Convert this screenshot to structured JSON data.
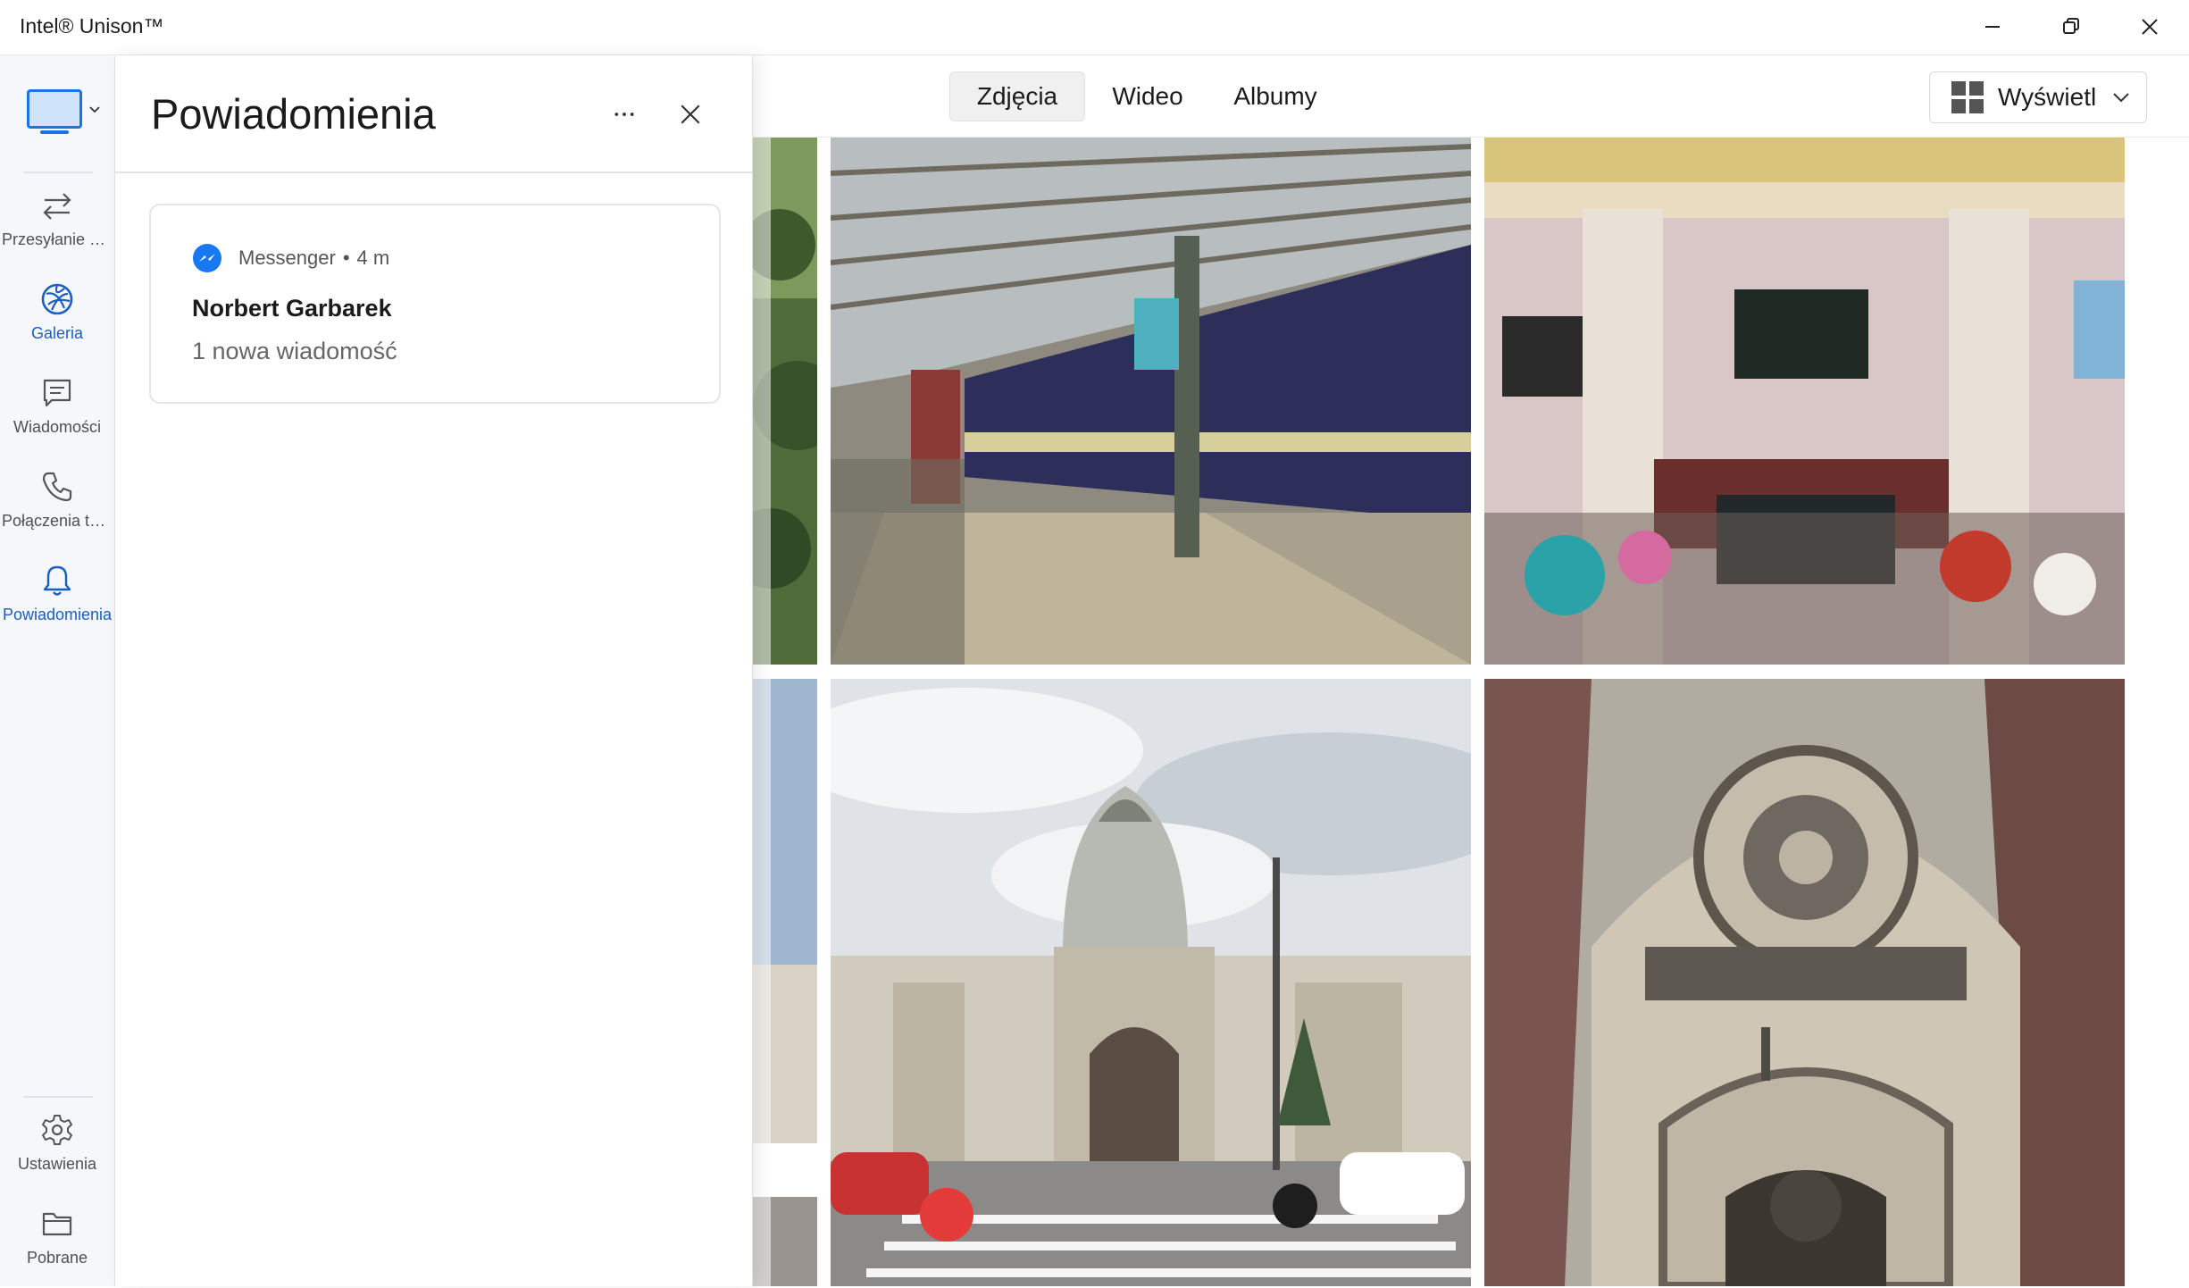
{
  "window": {
    "title": "Intel® Unison™",
    "minimize_icon": "minimize-icon",
    "maximize_icon": "restore-icon",
    "close_icon": "close-icon"
  },
  "sidebar": {
    "device_icon": "laptop-icon",
    "items": [
      {
        "label": "Przesyłanie plików",
        "icon": "transfer-arrows-icon"
      },
      {
        "label": "Galeria",
        "icon": "gallery-icon",
        "active": true
      },
      {
        "label": "Wiadomości",
        "icon": "chat-icon"
      },
      {
        "label": "Połączenia telefoniczne",
        "icon": "phone-icon"
      },
      {
        "label": "Powiadomienia",
        "icon": "bell-icon",
        "active": true
      }
    ],
    "bottom": [
      {
        "label": "Ustawienia",
        "icon": "gear-icon"
      },
      {
        "label": "Pobrane",
        "icon": "folder-icon"
      }
    ],
    "accent_color": "#1a5fbf"
  },
  "notifications": {
    "title": "Powiadomienia",
    "more_icon": "more-dots-icon",
    "close_icon": "close-icon",
    "cards": [
      {
        "app": "Messenger",
        "separator": "•",
        "time": "4 m",
        "sender": "Norbert Garbarek",
        "message": "1 nowa wiadomość",
        "app_icon": "messenger-icon",
        "app_color": "#1877f2"
      }
    ]
  },
  "gallery": {
    "tabs": [
      {
        "label": "Zdjęcia",
        "selected": true
      },
      {
        "label": "Wideo",
        "selected": false
      },
      {
        "label": "Albumy",
        "selected": false
      }
    ],
    "view_button": {
      "label": "Wyświetl",
      "icon": "grid-view-icon"
    },
    "photos": [
      {
        "subject": "trees-partial"
      },
      {
        "subject": "train-station-platform"
      },
      {
        "subject": "station-hall-interior"
      },
      {
        "subject": "station-facade-partial"
      },
      {
        "subject": "lviv-railway-station-exterior"
      },
      {
        "subject": "gothic-church-facade"
      }
    ]
  }
}
